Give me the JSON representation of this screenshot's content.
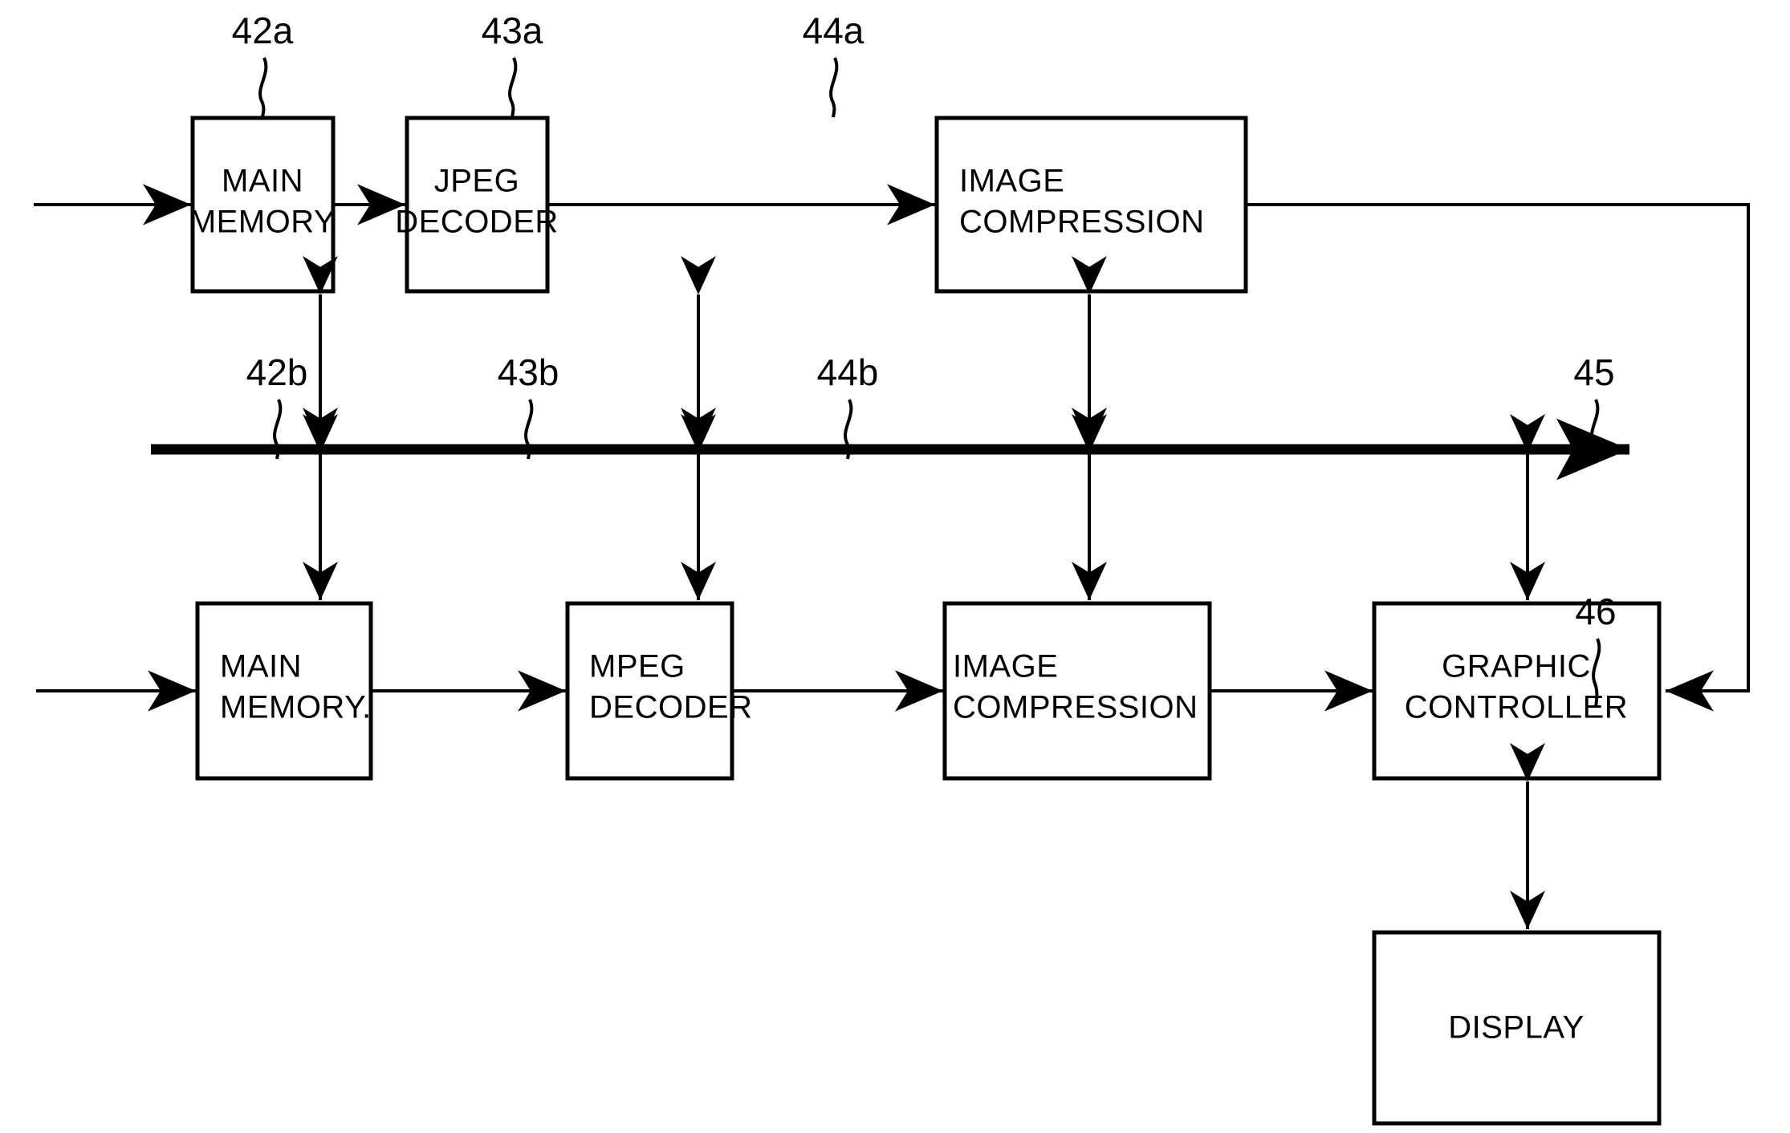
{
  "figure": {
    "type": "block-diagram",
    "background_color": "#ffffff",
    "line_color": "#000000"
  },
  "blocks": [
    {
      "id": "42a",
      "ref": "42a",
      "line1": "MAIN",
      "line2": "MEMORY",
      "row": "top"
    },
    {
      "id": "43a",
      "ref": "43a",
      "line1": "JPEG",
      "line2": "DECODER",
      "row": "top"
    },
    {
      "id": "44a",
      "ref": "44a",
      "line1": "IMAGE",
      "line2": "COMPRESSION",
      "row": "top"
    },
    {
      "id": "42b",
      "ref": "42b",
      "line1": "MAIN",
      "line2": "MEMORY.",
      "row": "bottom"
    },
    {
      "id": "43b",
      "ref": "43b",
      "line1": "MPEG",
      "line2": "DECODER",
      "row": "bottom"
    },
    {
      "id": "44b",
      "ref": "44b",
      "line1": "IMAGE",
      "line2": "COMPRESSION",
      "row": "bottom"
    },
    {
      "id": "45",
      "ref": "45",
      "line1": "GRAPHIC",
      "line2": "CONTROLLER",
      "row": "bottom"
    },
    {
      "id": "46",
      "ref": "46",
      "line1": "DISPLAY",
      "line2": "",
      "row": "display"
    }
  ],
  "bus": {
    "name": "system-bus",
    "direction": "right"
  },
  "connections": [
    {
      "from": "input-top",
      "to": "42a",
      "kind": "arrow-right"
    },
    {
      "from": "42a",
      "to": "43a",
      "kind": "arrow-right"
    },
    {
      "from": "43a",
      "to": "44a",
      "kind": "arrow-right"
    },
    {
      "from": "44a",
      "to": "45",
      "kind": "feedback-right-down"
    },
    {
      "from": "input-bottom",
      "to": "42b",
      "kind": "arrow-right"
    },
    {
      "from": "42b",
      "to": "43b",
      "kind": "arrow-right"
    },
    {
      "from": "43b",
      "to": "44b",
      "kind": "arrow-right"
    },
    {
      "from": "44b",
      "to": "45",
      "kind": "arrow-right"
    },
    {
      "from": "45",
      "to": "46",
      "kind": "double-arrow-vertical"
    },
    {
      "from": "42a",
      "to": "bus",
      "kind": "double-arrow-vertical"
    },
    {
      "from": "43a",
      "to": "bus",
      "kind": "double-arrow-vertical"
    },
    {
      "from": "44a",
      "to": "bus",
      "kind": "double-arrow-vertical"
    },
    {
      "from": "bus",
      "to": "42b",
      "kind": "double-arrow-vertical"
    },
    {
      "from": "bus",
      "to": "43b",
      "kind": "double-arrow-vertical"
    },
    {
      "from": "bus",
      "to": "44b",
      "kind": "double-arrow-vertical"
    },
    {
      "from": "bus",
      "to": "45",
      "kind": "double-arrow-vertical"
    }
  ]
}
